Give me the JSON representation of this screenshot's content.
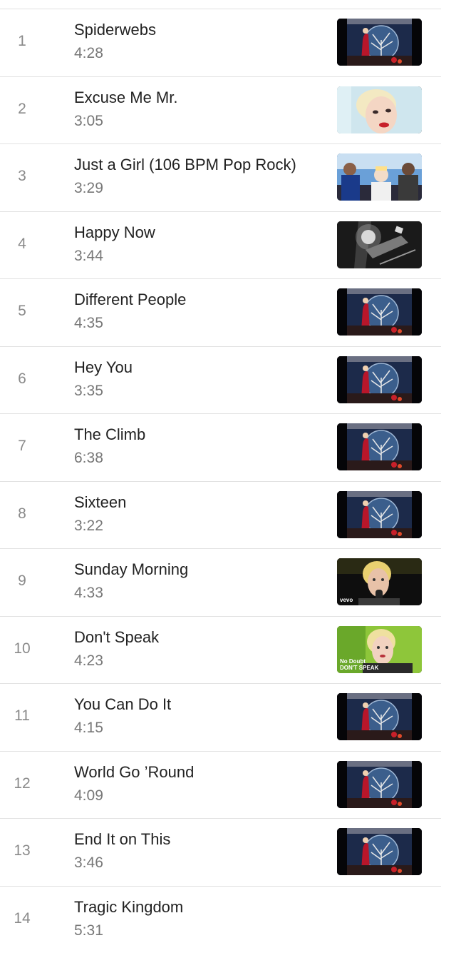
{
  "tracks": [
    {
      "number": "1",
      "title": "Spiderwebs",
      "duration": "4:28",
      "thumb": "album-art"
    },
    {
      "number": "2",
      "title": "Excuse Me Mr.",
      "duration": "3:05",
      "thumb": "bright-portrait"
    },
    {
      "number": "3",
      "title": "Just a Girl (106 BPM Pop Rock)",
      "duration": "3:29",
      "thumb": "band-group"
    },
    {
      "number": "4",
      "title": "Happy Now",
      "duration": "3:44",
      "thumb": "bw-concert"
    },
    {
      "number": "5",
      "title": "Different People",
      "duration": "4:35",
      "thumb": "album-art"
    },
    {
      "number": "6",
      "title": "Hey You",
      "duration": "3:35",
      "thumb": "album-art"
    },
    {
      "number": "7",
      "title": "The Climb",
      "duration": "6:38",
      "thumb": "album-art"
    },
    {
      "number": "8",
      "title": "Sixteen",
      "duration": "3:22",
      "thumb": "album-art"
    },
    {
      "number": "9",
      "title": "Sunday Morning",
      "duration": "4:33",
      "thumb": "singer-mic",
      "caption": "vevo"
    },
    {
      "number": "10",
      "title": "Don't Speak",
      "duration": "4:23",
      "thumb": "singer-green",
      "caption": "No Doubt\nDON'T SPEAK"
    },
    {
      "number": "11",
      "title": "You Can Do It",
      "duration": "4:15",
      "thumb": "album-art"
    },
    {
      "number": "12",
      "title": "World Go ’Round",
      "duration": "4:09",
      "thumb": "album-art"
    },
    {
      "number": "13",
      "title": "End It on This",
      "duration": "3:46",
      "thumb": "album-art"
    },
    {
      "number": "14",
      "title": "Tragic Kingdom",
      "duration": "5:31",
      "thumb": ""
    }
  ]
}
